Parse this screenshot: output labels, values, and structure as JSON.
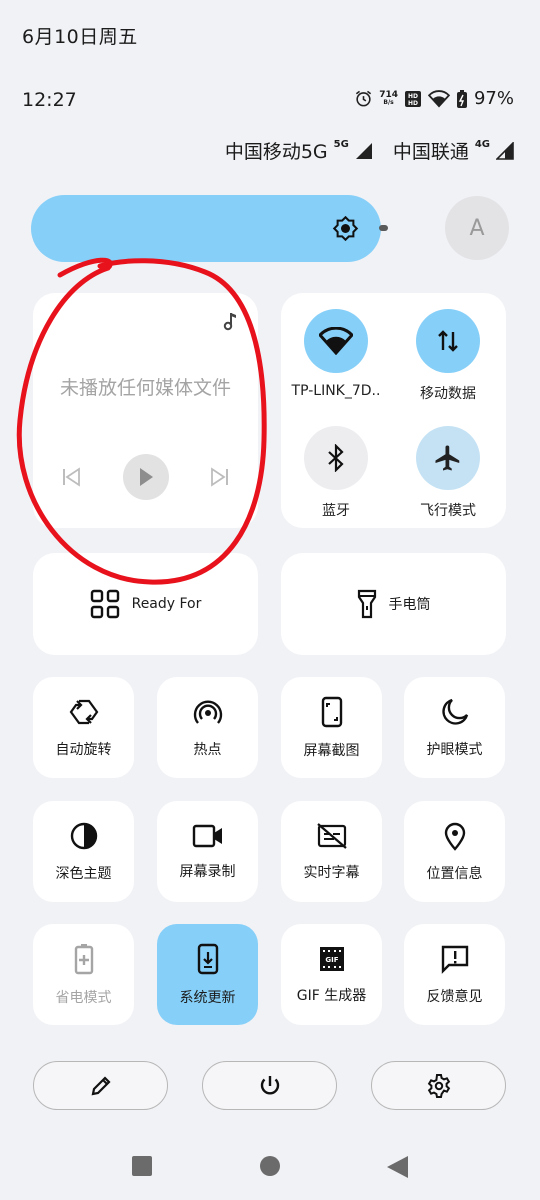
{
  "status": {
    "date": "6月10日周五",
    "time": "12:27",
    "netspeed_value": "714",
    "netspeed_unit": "B/s",
    "battery": "97%"
  },
  "carriers": [
    {
      "name": "中国移动5G",
      "gen": "5G"
    },
    {
      "name": "中国联通",
      "gen": "4G"
    }
  ],
  "avatar_letter": "A",
  "media": {
    "message": "未播放任何媒体文件"
  },
  "connectivity": [
    {
      "label": "TP-LINK_7D..",
      "icon": "wifi-icon",
      "active": true
    },
    {
      "label": "移动数据",
      "icon": "mobile-data-icon",
      "active": true
    },
    {
      "label": "蓝牙",
      "icon": "bluetooth-icon",
      "active": false
    },
    {
      "label": "飞行模式",
      "icon": "airplane-icon",
      "active": false
    }
  ],
  "wide_tiles": [
    {
      "label": "Ready For",
      "icon": "grid-icon"
    },
    {
      "label": "手电筒",
      "icon": "flashlight-icon"
    }
  ],
  "tiles": [
    {
      "label": "自动旋转",
      "icon": "auto-rotate-icon"
    },
    {
      "label": "热点",
      "icon": "hotspot-icon"
    },
    {
      "label": "屏幕截图",
      "icon": "screenshot-icon"
    },
    {
      "label": "护眼模式",
      "icon": "moon-icon"
    },
    {
      "label": "深色主题",
      "icon": "dark-theme-icon"
    },
    {
      "label": "屏幕录制",
      "icon": "screen-record-icon"
    },
    {
      "label": "实时字幕",
      "icon": "live-caption-icon"
    },
    {
      "label": "位置信息",
      "icon": "location-icon"
    },
    {
      "label": "省电模式",
      "icon": "battery-saver-icon"
    },
    {
      "label": "系统更新",
      "icon": "system-update-icon"
    },
    {
      "label": "GIF 生成器",
      "icon": "gif-icon"
    },
    {
      "label": "反馈意见",
      "icon": "feedback-icon"
    }
  ],
  "colors": {
    "accent": "#86cff8",
    "background": "#f1f2f6",
    "annotation": "#e8121c"
  }
}
